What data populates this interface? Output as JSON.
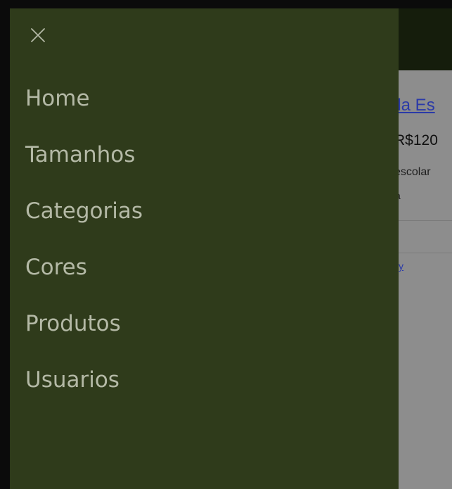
{
  "background_page": {
    "product_title": "ila Es",
    "product_price": "R$120",
    "product_desc_line1": "escolar",
    "product_desc_line2": "a",
    "small_link": "y"
  },
  "sidenav": {
    "close_icon": "close-icon",
    "items": [
      {
        "label": "Home"
      },
      {
        "label": "Tamanhos"
      },
      {
        "label": "Categorias"
      },
      {
        "label": "Cores"
      },
      {
        "label": "Produtos"
      },
      {
        "label": "Usuarios"
      }
    ]
  },
  "colors": {
    "sidenav_bg": "#2f3b1b",
    "nav_text": "#b4b9a6",
    "header_bg": "#151d0c",
    "overlay_bg": "#8d8d8d",
    "link": "#2b3aa8"
  }
}
